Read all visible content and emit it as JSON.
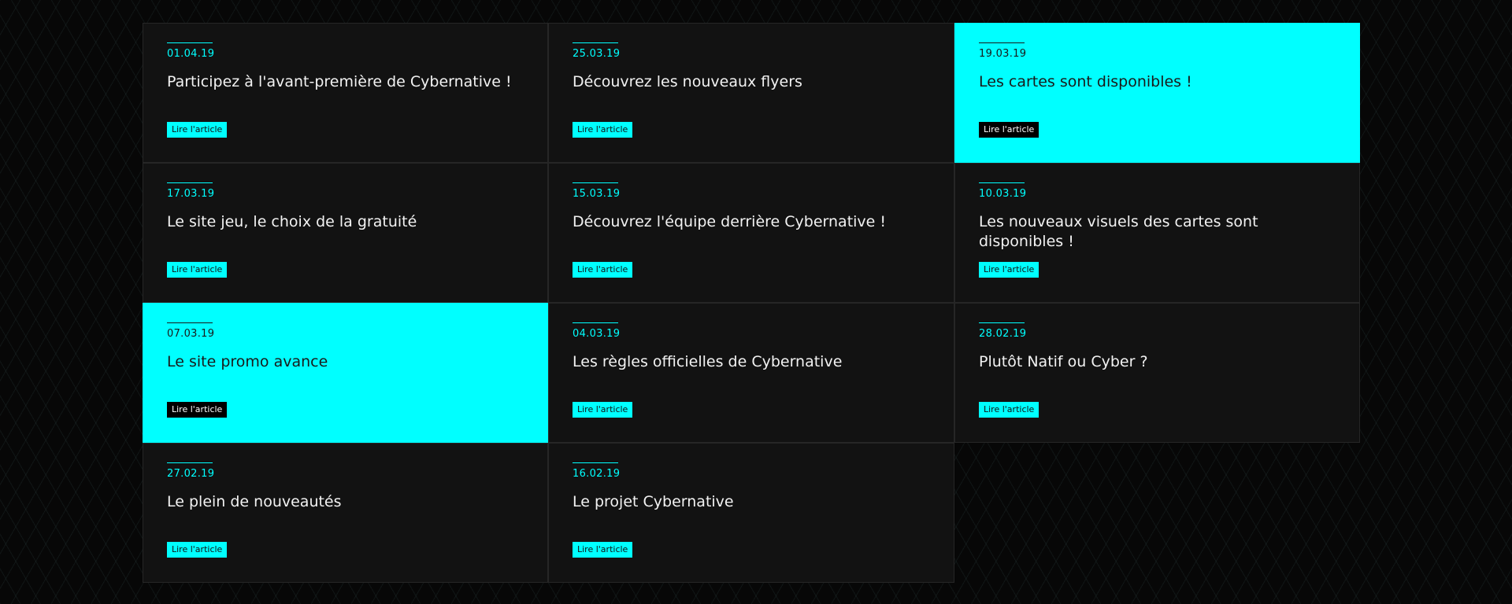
{
  "articles": [
    {
      "date": "01.04.19",
      "title": "Participez à l'avant-première de Cybernative !",
      "button": "Lire l'article",
      "highlighted": false
    },
    {
      "date": "25.03.19",
      "title": "Découvrez les nouveaux flyers",
      "button": "Lire l'article",
      "highlighted": false
    },
    {
      "date": "19.03.19",
      "title": "Les cartes sont disponibles !",
      "button": "Lire l'article",
      "highlighted": true
    },
    {
      "date": "17.03.19",
      "title": "Le site jeu, le choix de la gratuité",
      "button": "Lire l'article",
      "highlighted": false
    },
    {
      "date": "15.03.19",
      "title": "Découvrez l'équipe derrière Cybernative !",
      "button": "Lire l'article",
      "highlighted": false
    },
    {
      "date": "10.03.19",
      "title": "Les nouveaux visuels des cartes sont disponibles !",
      "button": "Lire l'article",
      "highlighted": false
    },
    {
      "date": "07.03.19",
      "title": "Le site promo avance",
      "button": "Lire l'article",
      "highlighted": true
    },
    {
      "date": "04.03.19",
      "title": "Les règles officielles de Cybernative",
      "button": "Lire l'article",
      "highlighted": false
    },
    {
      "date": "28.02.19",
      "title": "Plutôt Natif ou Cyber ?",
      "button": "Lire l'article",
      "highlighted": false
    },
    {
      "date": "27.02.19",
      "title": "Le plein de nouveautés",
      "button": "Lire l'article",
      "highlighted": false
    },
    {
      "date": "16.02.19",
      "title": "Le projet Cybernative",
      "button": "Lire l'article",
      "highlighted": false
    }
  ],
  "colors": {
    "accent": "#00ffff",
    "card_background": "#121212",
    "page_background": "#070707"
  }
}
